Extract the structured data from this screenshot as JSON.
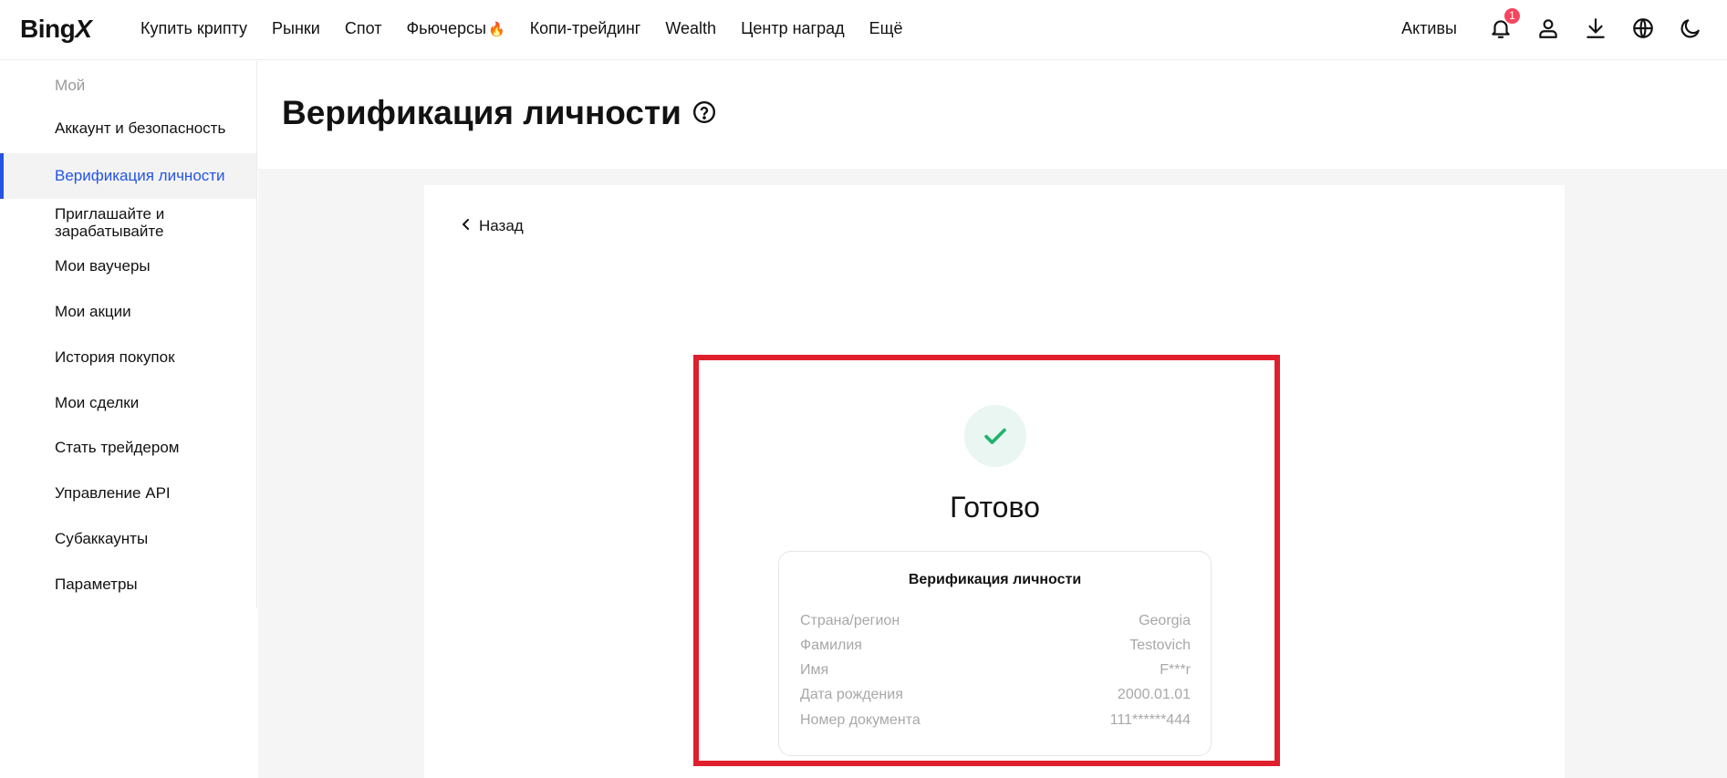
{
  "logo": {
    "text_main": "Bing",
    "text_x": "X"
  },
  "nav": {
    "items": [
      "Купить крипту",
      "Рынки",
      "Спот",
      "Фьючерсы",
      "Копи-трейдинг",
      "Wealth",
      "Центр наград",
      "Ещё"
    ],
    "fire_icon": "fire-icon"
  },
  "header_right": {
    "assets_label": "Активы",
    "notification_count": "1",
    "icons": [
      "bell-icon",
      "user-icon",
      "download-icon",
      "globe-icon",
      "moon-icon"
    ]
  },
  "sidebar": {
    "heading": "Мой",
    "items": [
      {
        "label": "Аккаунт и безопасность",
        "active": false
      },
      {
        "label": "Верификация личности",
        "active": true
      },
      {
        "label": "Приглашайте и зарабатывайте",
        "active": false
      },
      {
        "label": "Мои ваучеры",
        "active": false
      },
      {
        "label": "Мои акции",
        "active": false
      },
      {
        "label": "История покупок",
        "active": false
      },
      {
        "label": "Мои сделки",
        "active": false
      },
      {
        "label": "Стать трейдером",
        "active": false
      },
      {
        "label": "Управление API",
        "active": false
      },
      {
        "label": "Субаккаунты",
        "active": false
      },
      {
        "label": "Параметры",
        "active": false
      }
    ]
  },
  "page": {
    "title": "Верификация личности",
    "back_label": "Назад",
    "status_title": "Готово",
    "card": {
      "title": "Верификация личности",
      "rows": [
        {
          "label": "Страна/регион",
          "value": "Georgia"
        },
        {
          "label": "Фамилия",
          "value": "Testovich"
        },
        {
          "label": "Имя",
          "value": "F***r"
        },
        {
          "label": "Дата рождения",
          "value": "2000.01.01"
        },
        {
          "label": "Номер документа",
          "value": "111******444"
        }
      ]
    }
  },
  "colors": {
    "accent": "#2354e6",
    "success": "#20b26c",
    "highlight": "#e01f2d",
    "badge": "#f6465d"
  }
}
